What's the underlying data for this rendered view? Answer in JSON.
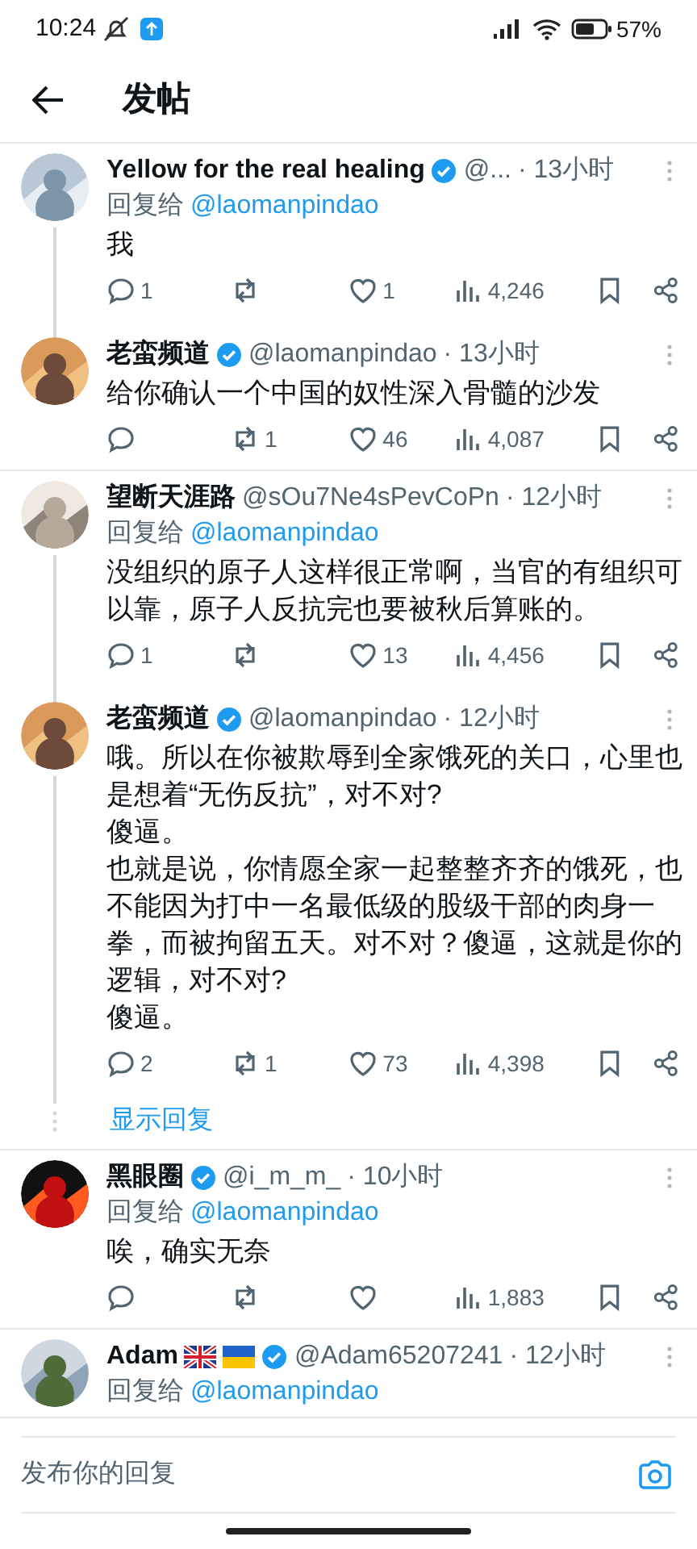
{
  "status_bar": {
    "time": "10:24",
    "battery": "57%"
  },
  "header": {
    "title": "发帖"
  },
  "conversations": [
    {
      "tweets": [
        {
          "name": "Yellow for the real healing",
          "verified": true,
          "handle": "@...",
          "time": "· 13小时",
          "reply_prefix": "回复给",
          "reply_to": "@laomanpindao",
          "text": [
            "我"
          ],
          "actions": {
            "replies": "1",
            "likes": "1",
            "views": "4,246"
          }
        },
        {
          "name": "老蛮频道",
          "verified": true,
          "handle": "@laomanpindao",
          "time": "· 13小时",
          "text": [
            "给你确认一个中国的奴性深入骨髓的沙发"
          ],
          "actions": {
            "retweets": "1",
            "likes": "46",
            "views": "4,087"
          }
        }
      ]
    },
    {
      "tweets": [
        {
          "name": "望断天涯路",
          "verified": false,
          "handle": "@sOu7Ne4sPevCoPn",
          "time": "· 12小时",
          "reply_prefix": "回复给",
          "reply_to": "@laomanpindao",
          "text": [
            "没组织的原子人这样很正常啊，当官的有组织可以靠，原子人反抗完也要被秋后算账的。"
          ],
          "actions": {
            "replies": "1",
            "likes": "13",
            "views": "4,456"
          }
        },
        {
          "name": "老蛮频道",
          "verified": true,
          "handle": "@laomanpindao",
          "time": "· 12小时",
          "text": [
            "哦。所以在你被欺辱到全家饿死的关口，心里也是想着“无伤反抗”，对不对?",
            "傻逼。",
            "也就是说，你情愿全家一起整整齐齐的饿死，也不能因为打中一名最低级的股级干部的肉身一拳，而被拘留五天。对不对？傻逼，这就是你的逻辑，对不对?",
            "傻逼。"
          ],
          "actions": {
            "replies": "2",
            "retweets": "1",
            "likes": "73",
            "views": "4,398"
          }
        }
      ],
      "show_replies": "显示回复"
    },
    {
      "tweets": [
        {
          "name": "黑眼圈",
          "verified": true,
          "handle": "@i_m_m_",
          "time": "· 10小时",
          "reply_prefix": "回复给",
          "reply_to": "@laomanpindao",
          "text": [
            "唉，确实无奈"
          ],
          "actions": {
            "views": "1,883"
          }
        }
      ]
    },
    {
      "tweets": [
        {
          "name": "Adam",
          "flags": [
            {
              "kind": "gb"
            },
            {
              "kind": "ua"
            }
          ],
          "verified": true,
          "handle": "@Adam65207241",
          "time": "· 12小时",
          "reply_prefix": "回复给",
          "reply_to": "@laomanpindao"
        }
      ]
    }
  ],
  "reply_bar": {
    "placeholder": "发布你的回复"
  }
}
